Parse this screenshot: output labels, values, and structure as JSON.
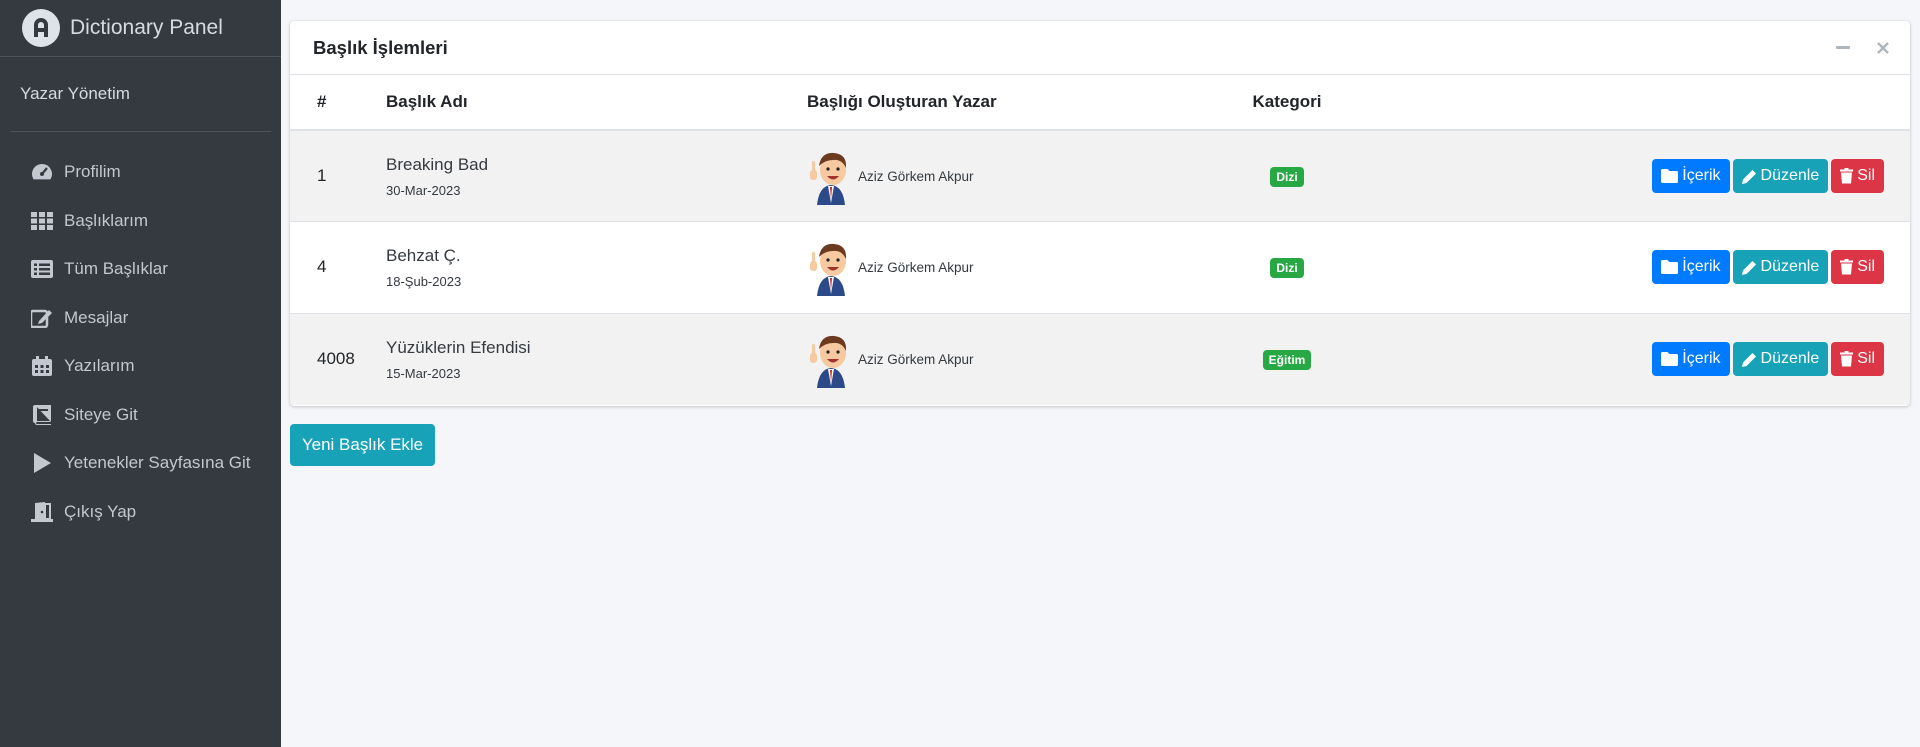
{
  "brand": {
    "title": "Dictionary Panel",
    "logo_icon": "brand-logo-icon"
  },
  "user_panel": {
    "name": "Yazar Yönetim"
  },
  "sidebar": {
    "items": [
      {
        "label": "Profilim",
        "icon": "tachometer-icon"
      },
      {
        "label": "Başlıklarım",
        "icon": "grid-icon"
      },
      {
        "label": "Tüm Başlıklar",
        "icon": "list-icon"
      },
      {
        "label": "Mesajlar",
        "icon": "edit-icon"
      },
      {
        "label": "Yazılarım",
        "icon": "calendar-icon"
      },
      {
        "label": "Siteye Git",
        "icon": "book-icon"
      },
      {
        "label": "Yetenekler Sayfasına Git",
        "icon": "play-icon"
      },
      {
        "label": "Çıkış Yap",
        "icon": "door-exit-icon"
      }
    ]
  },
  "card": {
    "title": "Başlık İşlemleri",
    "columns": [
      "#",
      "Başlık Adı",
      "Başlığı Oluşturan Yazar",
      "Kategori",
      ""
    ],
    "rows": [
      {
        "id": "1",
        "title": "Breaking Bad",
        "date": "30-Mar-2023",
        "author": "Aziz Görkem Akpur",
        "category": "Dizi"
      },
      {
        "id": "4",
        "title": "Behzat Ç.",
        "date": "18-Şub-2023",
        "author": "Aziz Görkem Akpur",
        "category": "Dizi"
      },
      {
        "id": "4008",
        "title": "Yüzüklerin Efendisi",
        "date": "15-Mar-2023",
        "author": "Aziz Görkem Akpur",
        "category": "Eğitim"
      }
    ],
    "actions": {
      "content": "İçerik",
      "edit": "Düzenle",
      "delete": "Sil"
    }
  },
  "add_button": "Yeni Başlık Ekle",
  "colors": {
    "sidebar": "#343a40",
    "primary": "#007bff",
    "info": "#17a2b8",
    "danger": "#dc3545",
    "success": "#28a745"
  }
}
